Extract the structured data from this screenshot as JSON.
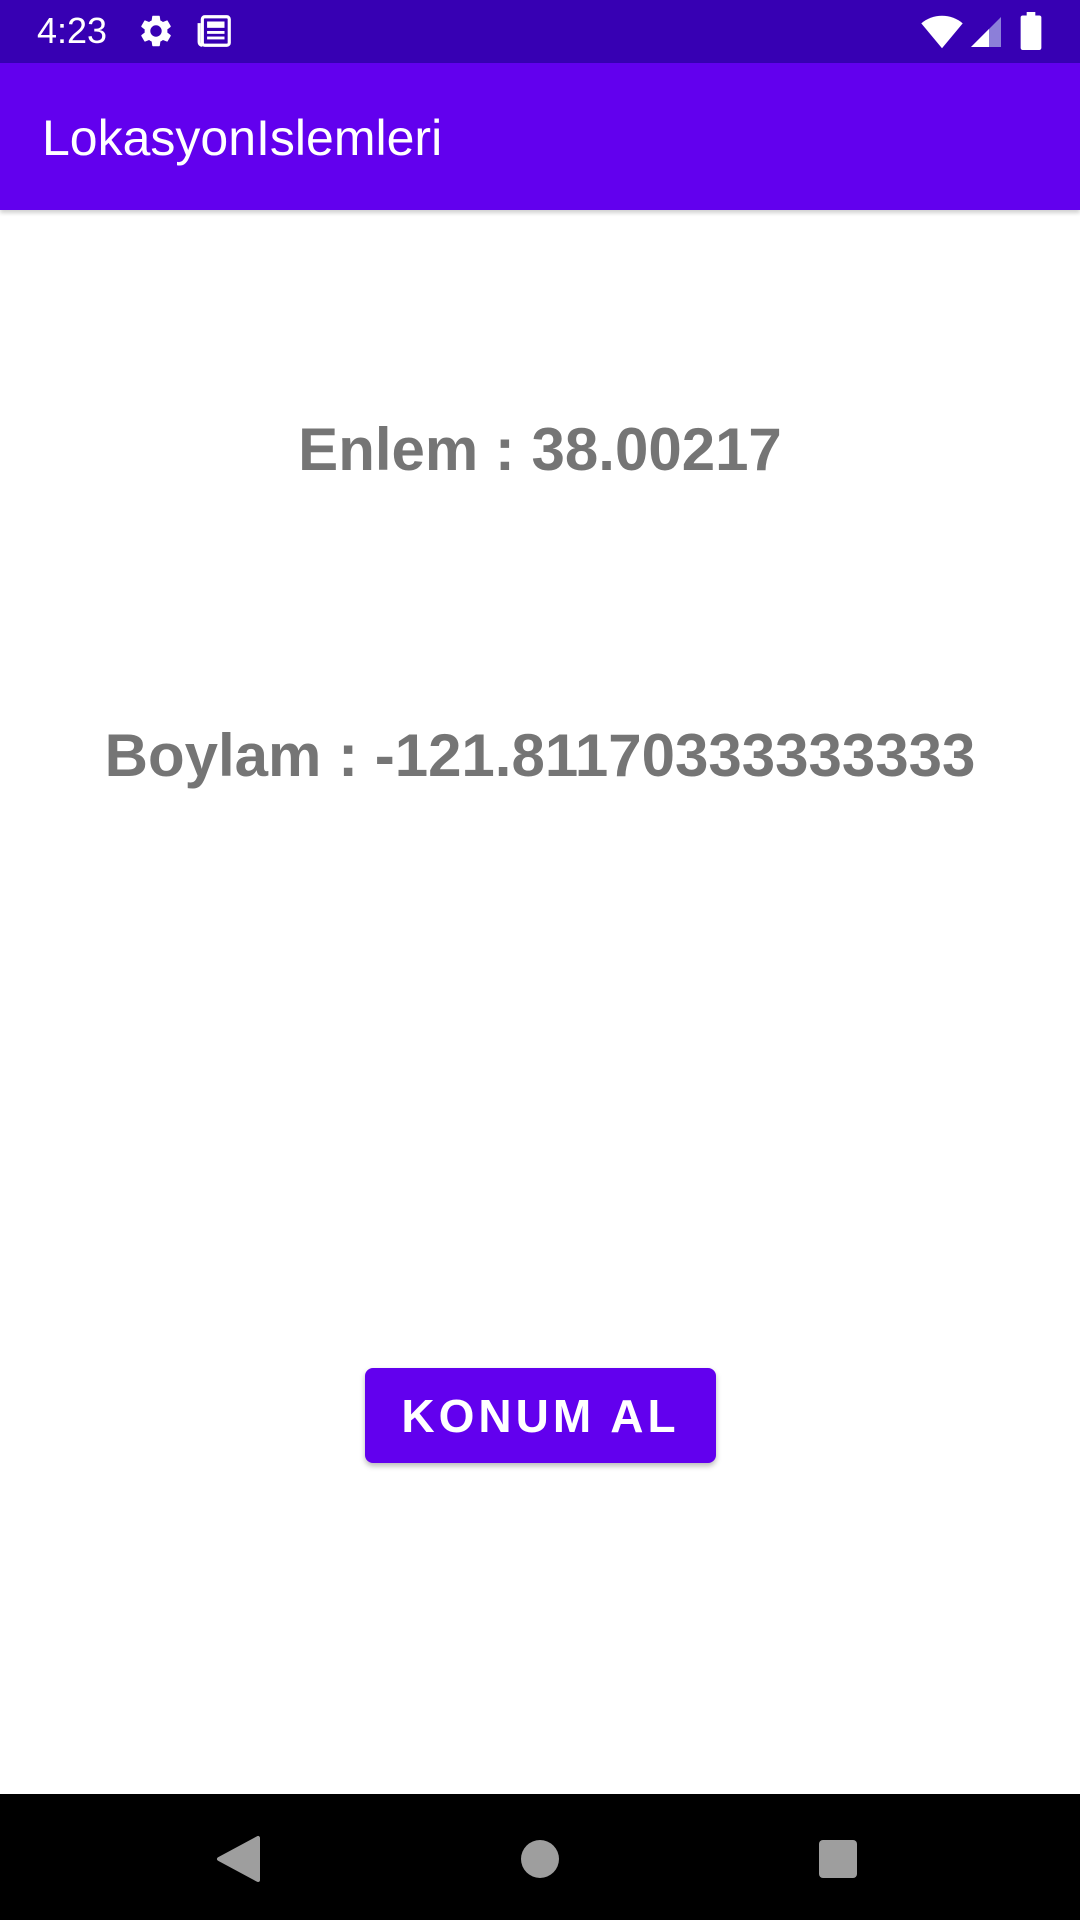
{
  "status_bar": {
    "time": "4:23",
    "icons": [
      "gear-icon",
      "news-icon",
      "wifi-icon",
      "signal-icon",
      "battery-icon"
    ],
    "background": "#3700b3"
  },
  "app_bar": {
    "title": "LokasyonIslemleri",
    "background": "#6200ee"
  },
  "content": {
    "latitude_text": "Enlem : 38.00217",
    "longitude_text": "Boylam : -121.81170333333333",
    "text_color": "#757575"
  },
  "actions": {
    "get_location_label": "KONUM AL",
    "button_color": "#6200ee"
  },
  "nav_bar": {
    "icons": [
      "back-icon",
      "home-icon",
      "recents-icon"
    ]
  }
}
